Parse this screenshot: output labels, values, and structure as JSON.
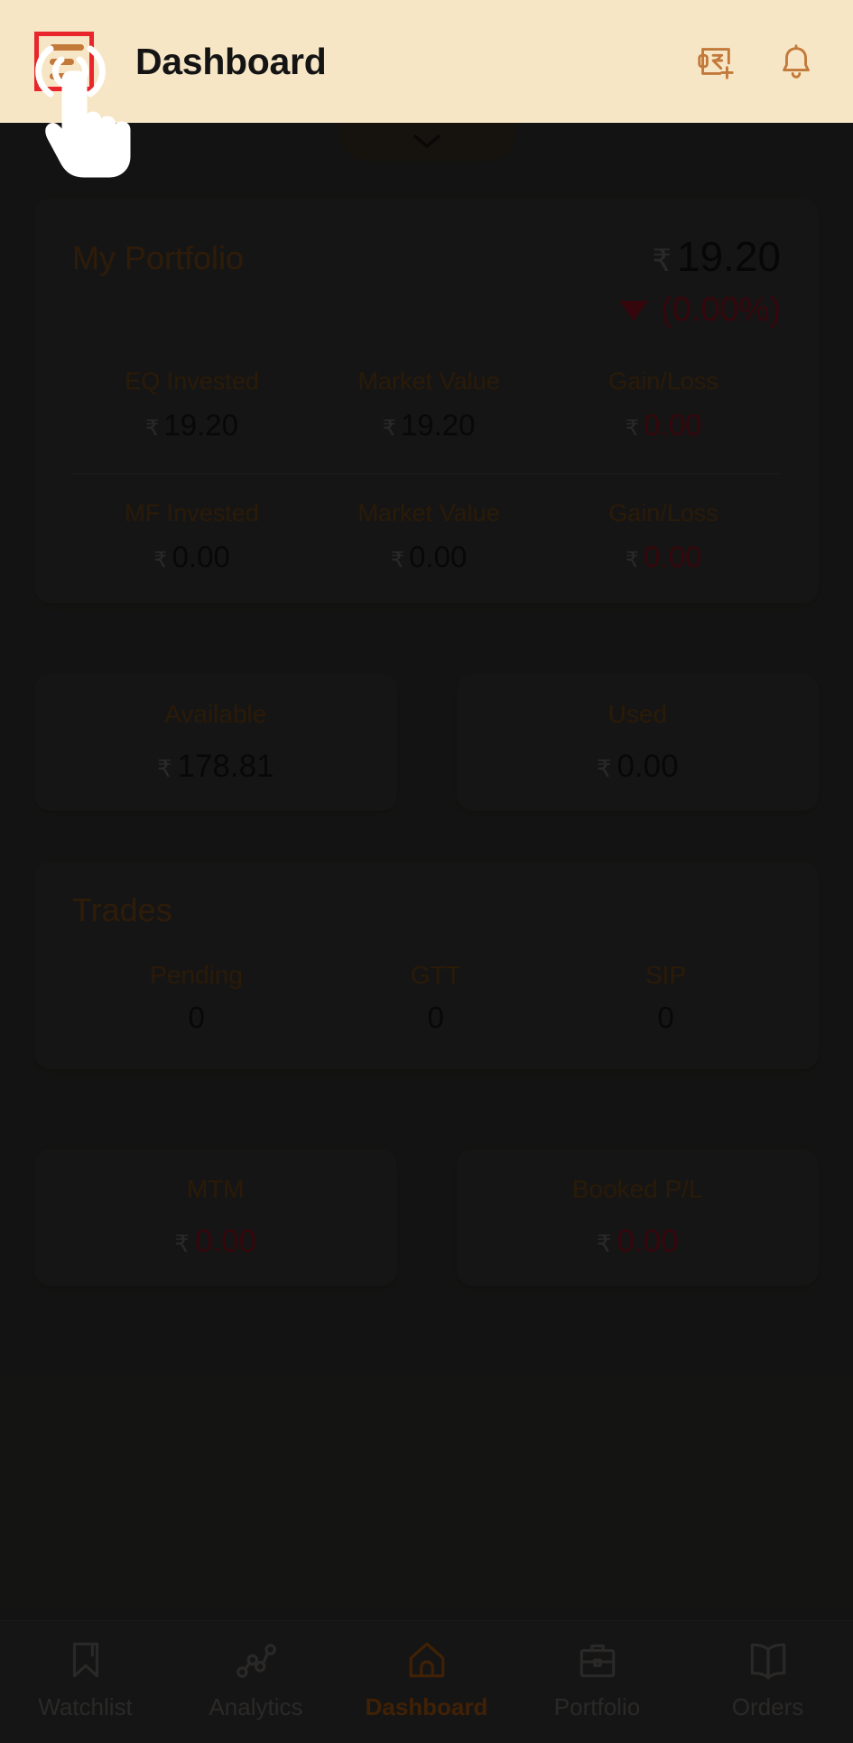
{
  "header": {
    "title": "Dashboard",
    "menu_icon": "hamburger-menu-icon",
    "add_funds_icon": "add-funds-rupee-icon",
    "notifications_icon": "bell-icon"
  },
  "pull_tab": {
    "icon": "chevron-down-icon"
  },
  "portfolio": {
    "title": "My Portfolio",
    "currency": "₹",
    "total_value": "19.20",
    "change_percent": "(0.00%)",
    "change_direction": "down",
    "rows": [
      {
        "invested_label": "EQ Invested",
        "invested_value": "19.20",
        "market_label": "Market Value",
        "market_value": "19.20",
        "gain_label": "Gain/Loss",
        "gain_value": "0.00"
      },
      {
        "invested_label": "MF Invested",
        "invested_value": "0.00",
        "market_label": "Market Value",
        "market_value": "0.00",
        "gain_label": "Gain/Loss",
        "gain_value": "0.00"
      }
    ]
  },
  "funds": {
    "available_label": "Available",
    "available_value": "178.81",
    "used_label": "Used",
    "used_value": "0.00"
  },
  "trades": {
    "title": "Trades",
    "items": [
      {
        "label": "Pending",
        "value": "0"
      },
      {
        "label": "GTT",
        "value": "0"
      },
      {
        "label": "SIP",
        "value": "0"
      }
    ]
  },
  "pnl": {
    "mtm_label": "MTM",
    "mtm_value": "0.00",
    "booked_label": "Booked P/L",
    "booked_value": "0.00"
  },
  "bottom_nav": {
    "items": [
      {
        "label": "Watchlist",
        "icon": "bookmark-icon",
        "active": false
      },
      {
        "label": "Analytics",
        "icon": "line-chart-icon",
        "active": false
      },
      {
        "label": "Dashboard",
        "icon": "home-icon",
        "active": true
      },
      {
        "label": "Portfolio",
        "icon": "briefcase-icon",
        "active": false
      },
      {
        "label": "Orders",
        "icon": "book-icon",
        "active": false
      }
    ]
  },
  "colors": {
    "header_bg": "#f7e6c6",
    "accent_brown": "#a8580f",
    "label_brown": "#6e4516",
    "negative_red": "#8d1420",
    "highlight_red": "#e8262b",
    "page_bg": "#353432",
    "card_bg": "#3a3937"
  },
  "currency_symbol": "₹"
}
